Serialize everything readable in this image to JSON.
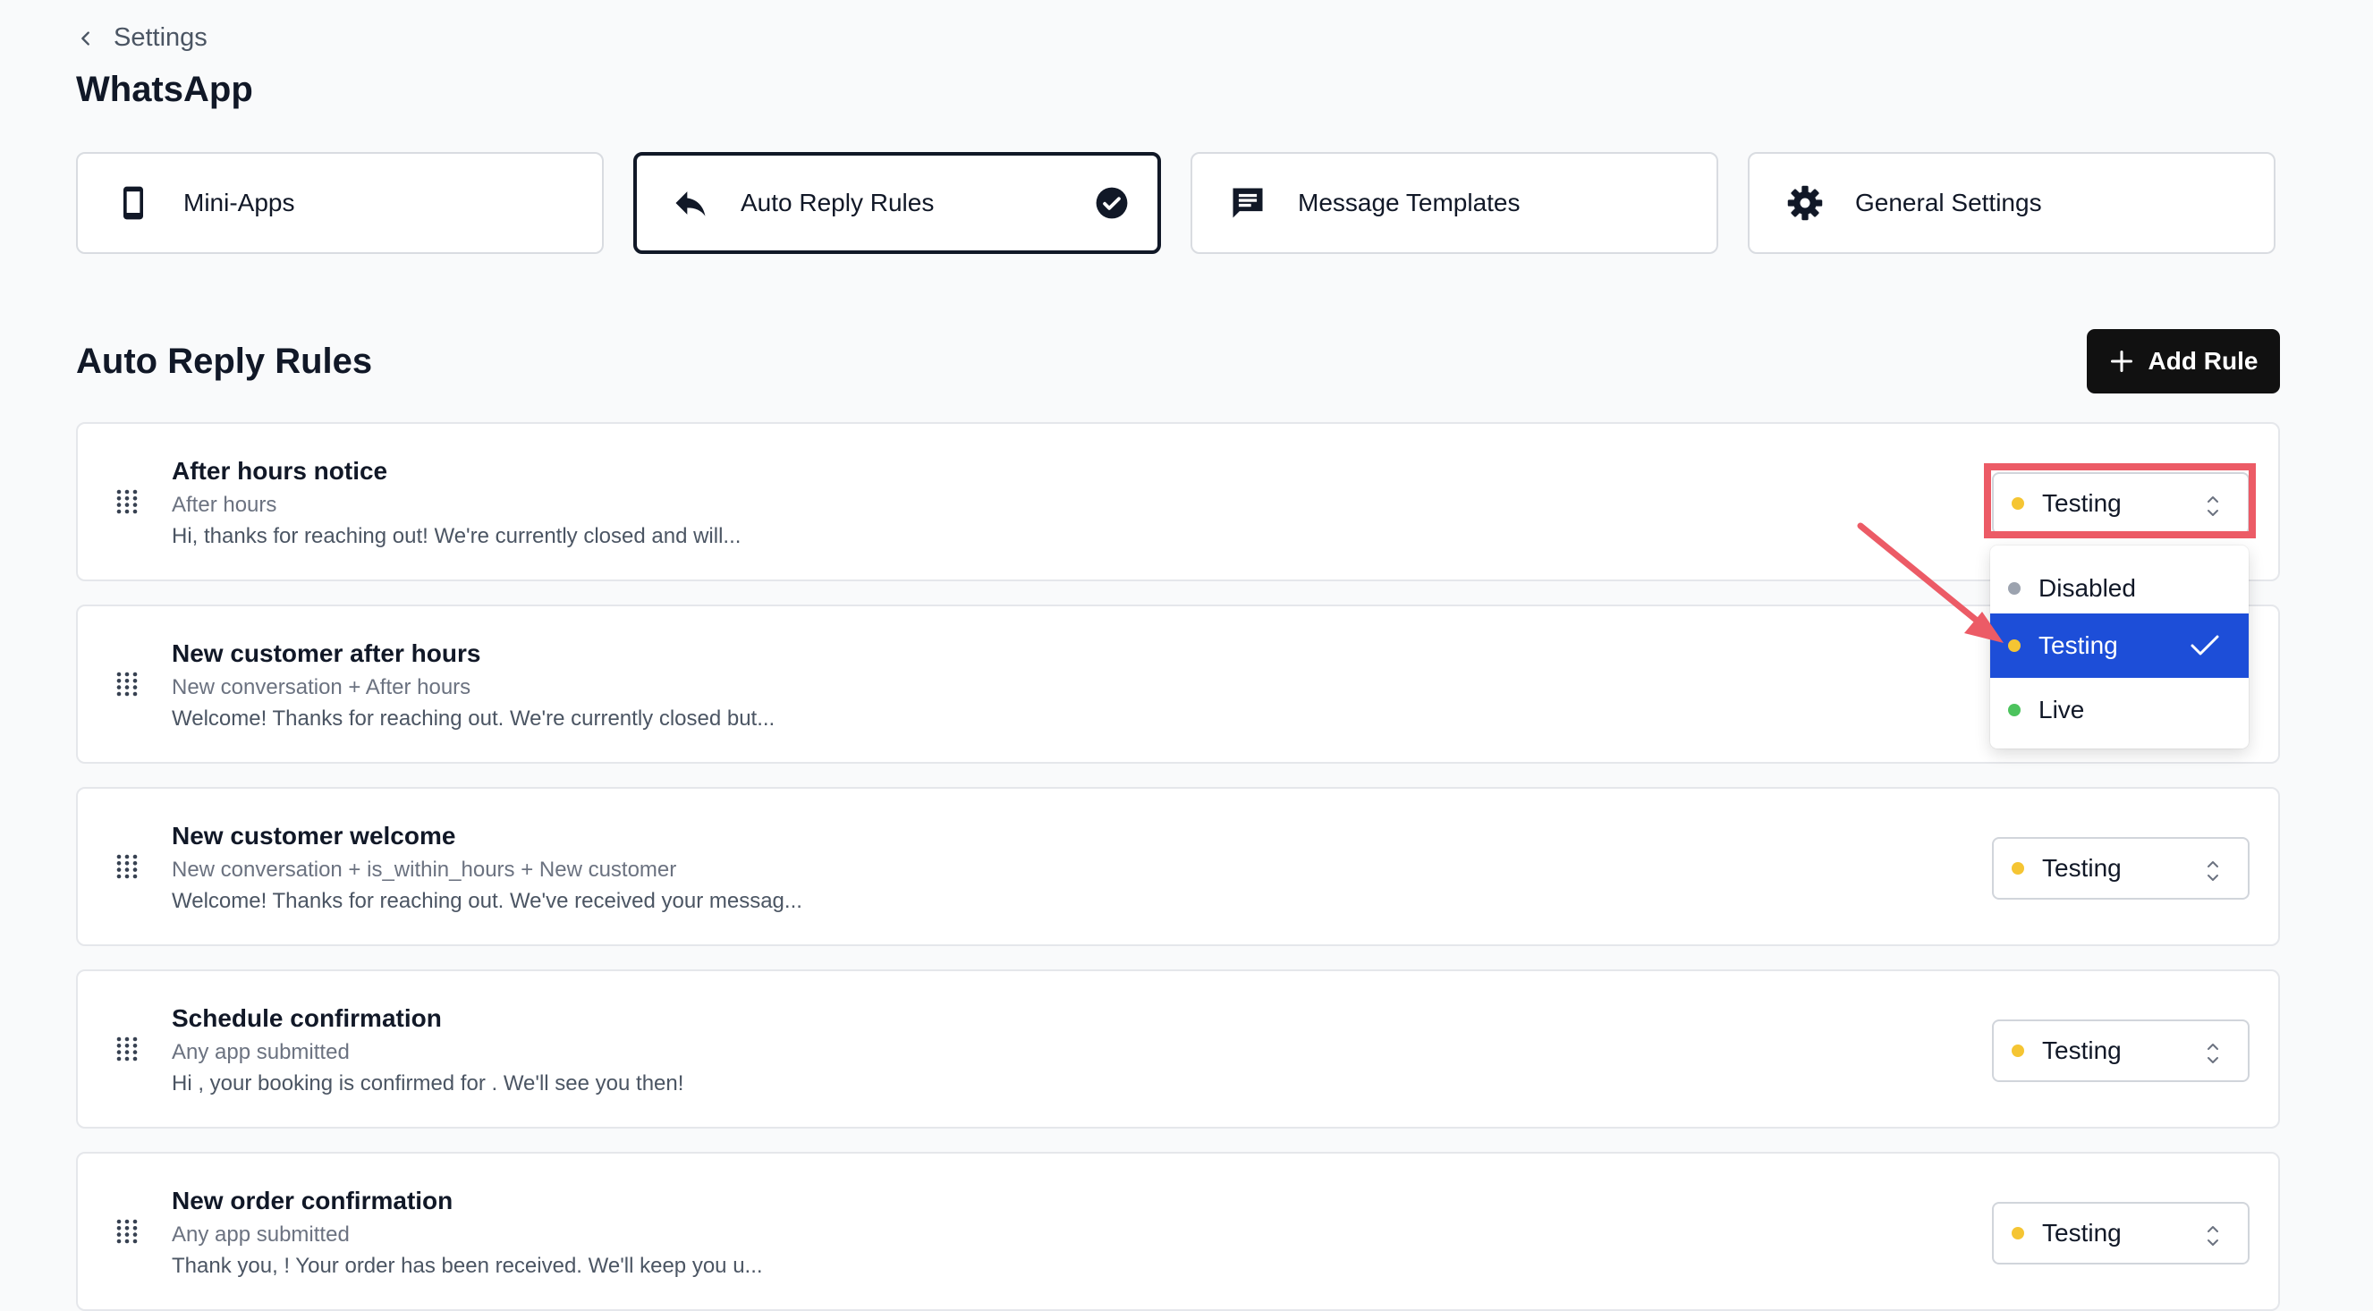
{
  "breadcrumb": {
    "back_label": "Settings"
  },
  "page_title": "WhatsApp",
  "tabs": [
    {
      "label": "Mini-Apps",
      "icon": "phone-icon",
      "active": false
    },
    {
      "label": "Auto Reply Rules",
      "icon": "reply-icon",
      "active": true
    },
    {
      "label": "Message Templates",
      "icon": "message-icon",
      "active": false
    },
    {
      "label": "General Settings",
      "icon": "gear-icon",
      "active": false
    }
  ],
  "section": {
    "title": "Auto Reply Rules",
    "add_button_label": "Add Rule"
  },
  "rules": [
    {
      "name": "After hours notice",
      "trigger": "After hours",
      "preview": "Hi, thanks for reaching out! We're currently closed and will...",
      "status": "Testing"
    },
    {
      "name": "New customer after hours",
      "trigger": "New conversation + After hours",
      "preview": "Welcome! Thanks for reaching out. We're currently closed but...",
      "status": "Testing"
    },
    {
      "name": "New customer welcome",
      "trigger": "New conversation + is_within_hours + New customer",
      "preview": "Welcome! Thanks for reaching out. We've received your messag...",
      "status": "Testing"
    },
    {
      "name": "Schedule confirmation",
      "trigger": "Any app submitted",
      "preview": "Hi , your booking is confirmed for . We'll see you then!",
      "status": "Testing"
    },
    {
      "name": "New order confirmation",
      "trigger": "Any app submitted",
      "preview": "Thank you, ! Your order has been received. We'll keep you u...",
      "status": "Testing"
    }
  ],
  "status_options": [
    {
      "label": "Disabled",
      "color": "#9ca3af",
      "selected": false
    },
    {
      "label": "Testing",
      "color": "#f5c533",
      "selected": true
    },
    {
      "label": "Live",
      "color": "#4cc35d",
      "selected": false
    }
  ],
  "colors": {
    "testing_dot": "#f5c533",
    "selected_option_bg": "#1d4ed8",
    "annotation": "#ec5b66",
    "primary_button": "#111111"
  }
}
